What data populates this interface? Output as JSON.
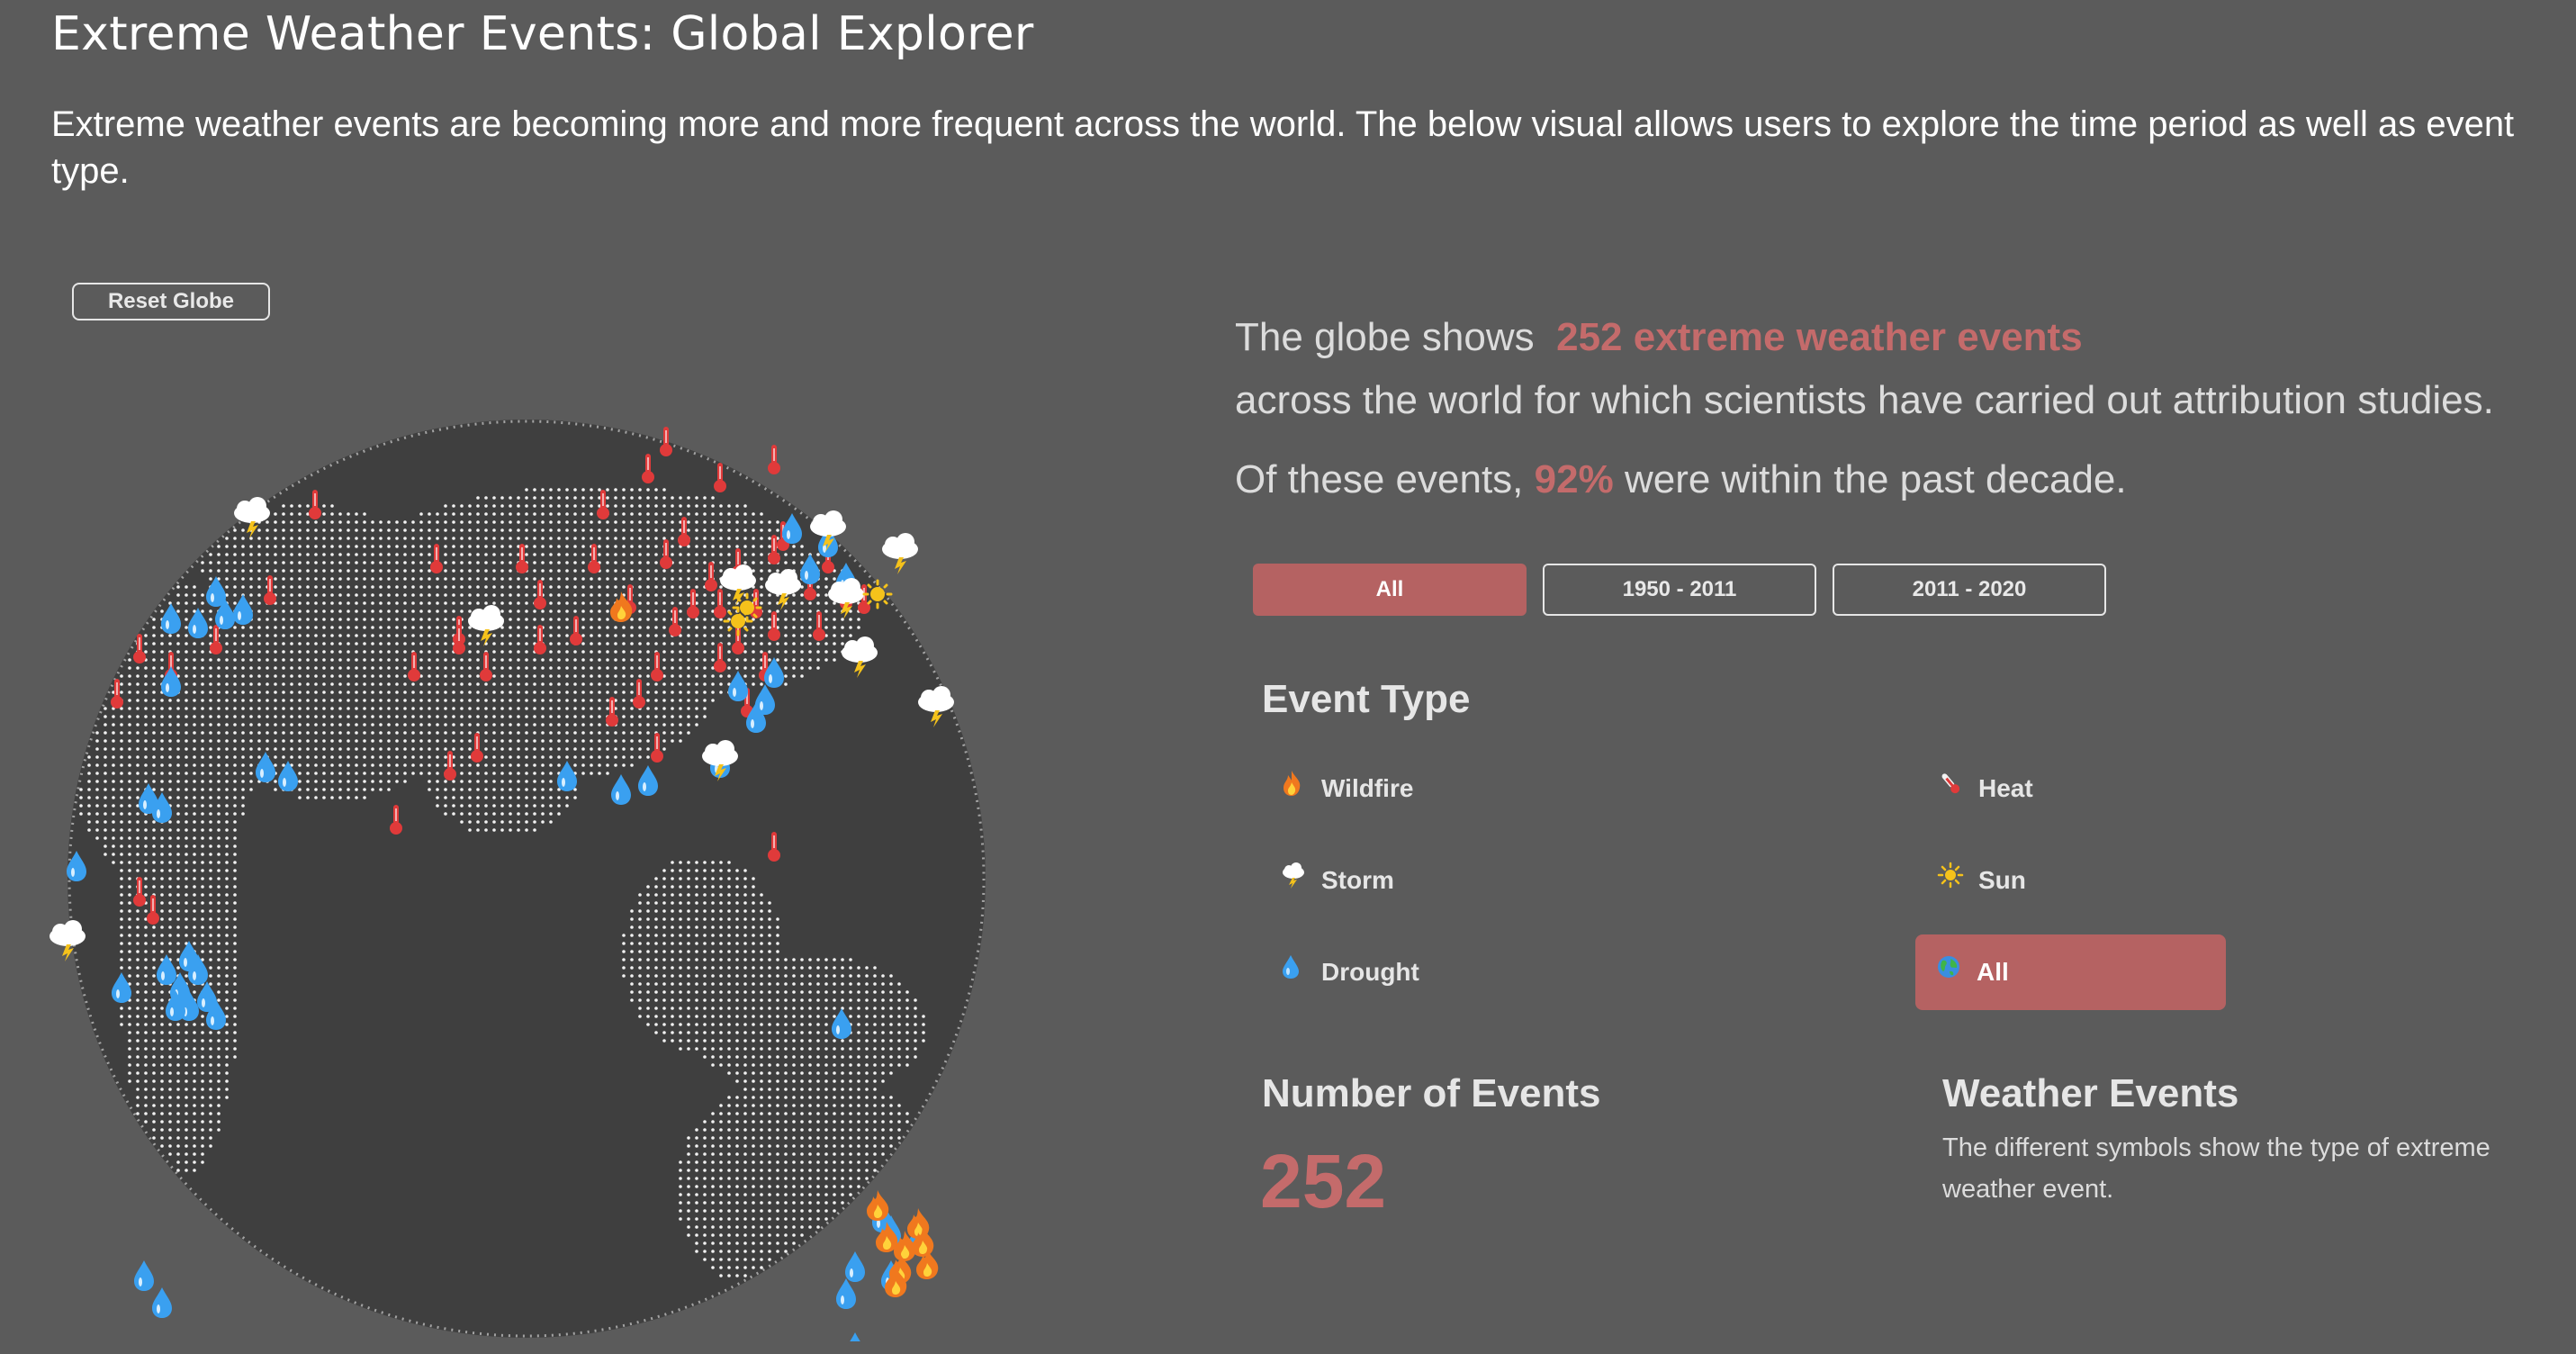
{
  "header": {
    "title": "Extreme Weather Events: Global Explorer",
    "intro": "Extreme weather events are becoming more and more frequent across the world. The below visual allows users to explore the time period as well as event type."
  },
  "globe": {
    "reset_label": "Reset Globe"
  },
  "summary": {
    "line1_prefix": "The globe shows",
    "line1_highlight": "252 extreme weather events",
    "line2": "across the world for which scientists have carried out attribution studies.",
    "line3_prefix": "Of these events,",
    "line3_highlight": "92%",
    "line3_suffix": "were within the past decade."
  },
  "periods": [
    {
      "label": "All",
      "active": true
    },
    {
      "label": "1950 - 2011",
      "active": false
    },
    {
      "label": "2011 - 2020",
      "active": false
    }
  ],
  "event_type": {
    "heading": "Event Type",
    "items": {
      "wildfire": {
        "label": "Wildfire",
        "icon": "fire-icon"
      },
      "storm": {
        "label": "Storm",
        "icon": "storm-cloud-icon"
      },
      "drought": {
        "label": "Drought",
        "icon": "droplet-icon"
      },
      "heat": {
        "label": "Heat",
        "icon": "thermometer-icon"
      },
      "sun": {
        "label": "Sun",
        "icon": "sun-icon"
      },
      "all": {
        "label": "All",
        "icon": "globe-icon",
        "active": true
      }
    }
  },
  "stats": {
    "number_heading": "Number of Events",
    "number_value": "252",
    "weather_heading": "Weather Events",
    "weather_desc": "The different symbols show the type of extreme weather event."
  },
  "colors": {
    "background": "#5b5b5b",
    "accent": "#c46b6b",
    "active_fill": "#b56262",
    "globe": "#3f3f3f",
    "heat_marker": "#e03a3a",
    "drought_marker": "#3aa0f0"
  }
}
